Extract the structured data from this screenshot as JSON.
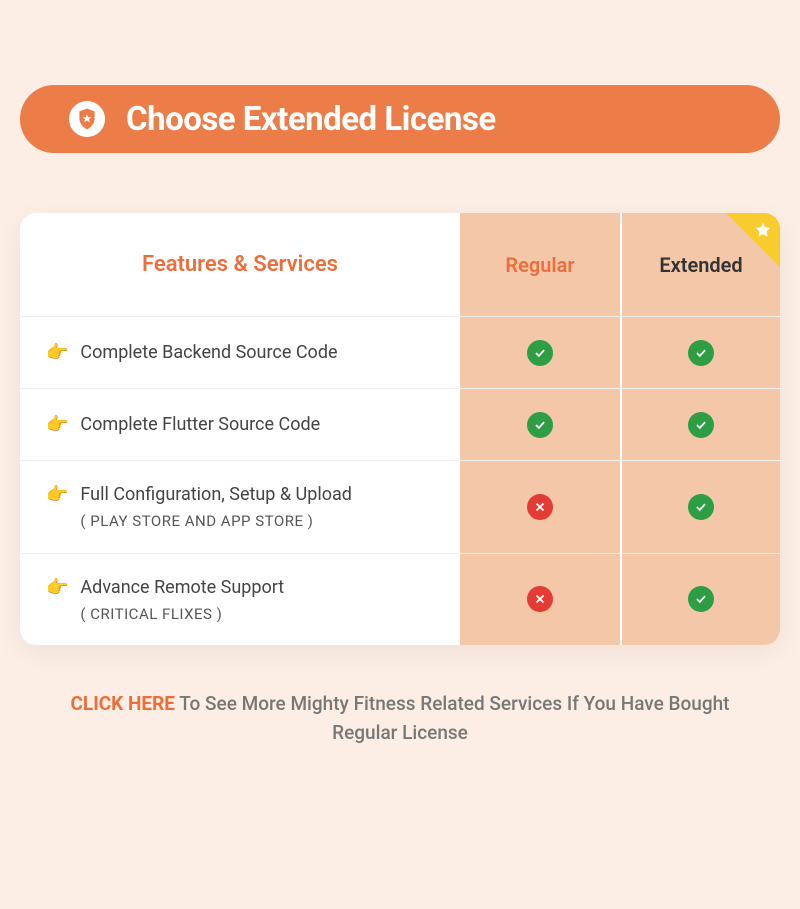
{
  "banner": {
    "title": "Choose Extended License"
  },
  "header": {
    "features": "Features & Services",
    "regular": "Regular",
    "extended": "Extended"
  },
  "rows": [
    {
      "label": "Complete Backend Source Code",
      "sub": "",
      "regular": true,
      "extended": true
    },
    {
      "label": "Complete Flutter Source Code",
      "sub": "",
      "regular": true,
      "extended": true
    },
    {
      "label": "Full Configuration, Setup & Upload",
      "sub": "( PLAY STORE AND APP STORE )",
      "regular": false,
      "extended": true
    },
    {
      "label": "Advance Remote Support",
      "sub": " ( CRITICAL FLIXES )",
      "regular": false,
      "extended": true
    }
  ],
  "footer": {
    "link": "CLICK HERE",
    "rest": " To See More Mighty Fitness Related Services If You Have Bought Regular License"
  }
}
